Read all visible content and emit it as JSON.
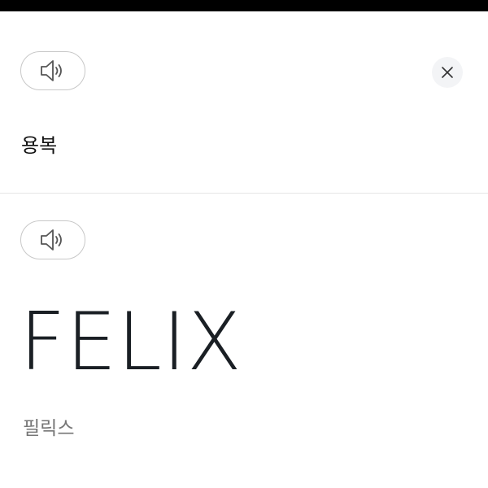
{
  "source": {
    "text": "용복",
    "speaker_icon": "speaker-icon"
  },
  "target": {
    "text": "FELIX",
    "pronunciation": "필릭스",
    "speaker_icon": "speaker-icon"
  },
  "close_icon": "close-icon",
  "colors": {
    "top_bar": "#000000",
    "background": "#ffffff",
    "primary_text": "#1a1f24",
    "secondary_text": "#767676",
    "pill_border": "#c8c8c8",
    "close_bg": "#f3f4f6",
    "divider": "#e6e6e6"
  }
}
